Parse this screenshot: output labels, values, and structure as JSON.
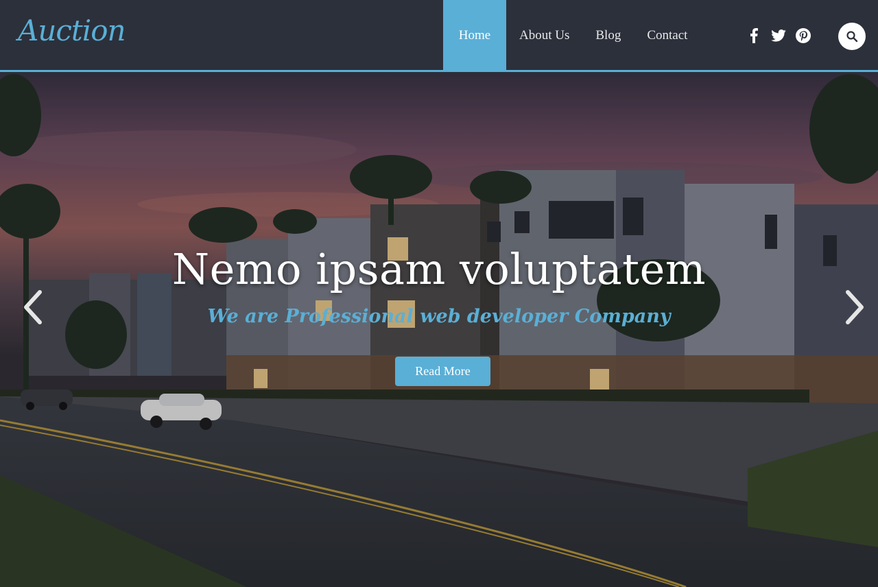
{
  "brand": {
    "logo_text": "Auction",
    "accent_color": "#5aafd6",
    "header_bg": "#2c303b"
  },
  "nav": {
    "items": [
      {
        "label": "Home",
        "active": true
      },
      {
        "label": "About Us",
        "active": false
      },
      {
        "label": "Blog",
        "active": false
      },
      {
        "label": "Contact",
        "active": false
      }
    ]
  },
  "social": {
    "icons": [
      "facebook-icon",
      "twitter-icon",
      "pinterest-icon"
    ]
  },
  "search": {
    "icon": "search-icon"
  },
  "hero": {
    "title": "Nemo ipsam voluptatem",
    "subtitle": "We are Professional web developer Company",
    "button_label": "Read More",
    "prev_icon": "chevron-left-icon",
    "next_icon": "chevron-right-icon"
  }
}
